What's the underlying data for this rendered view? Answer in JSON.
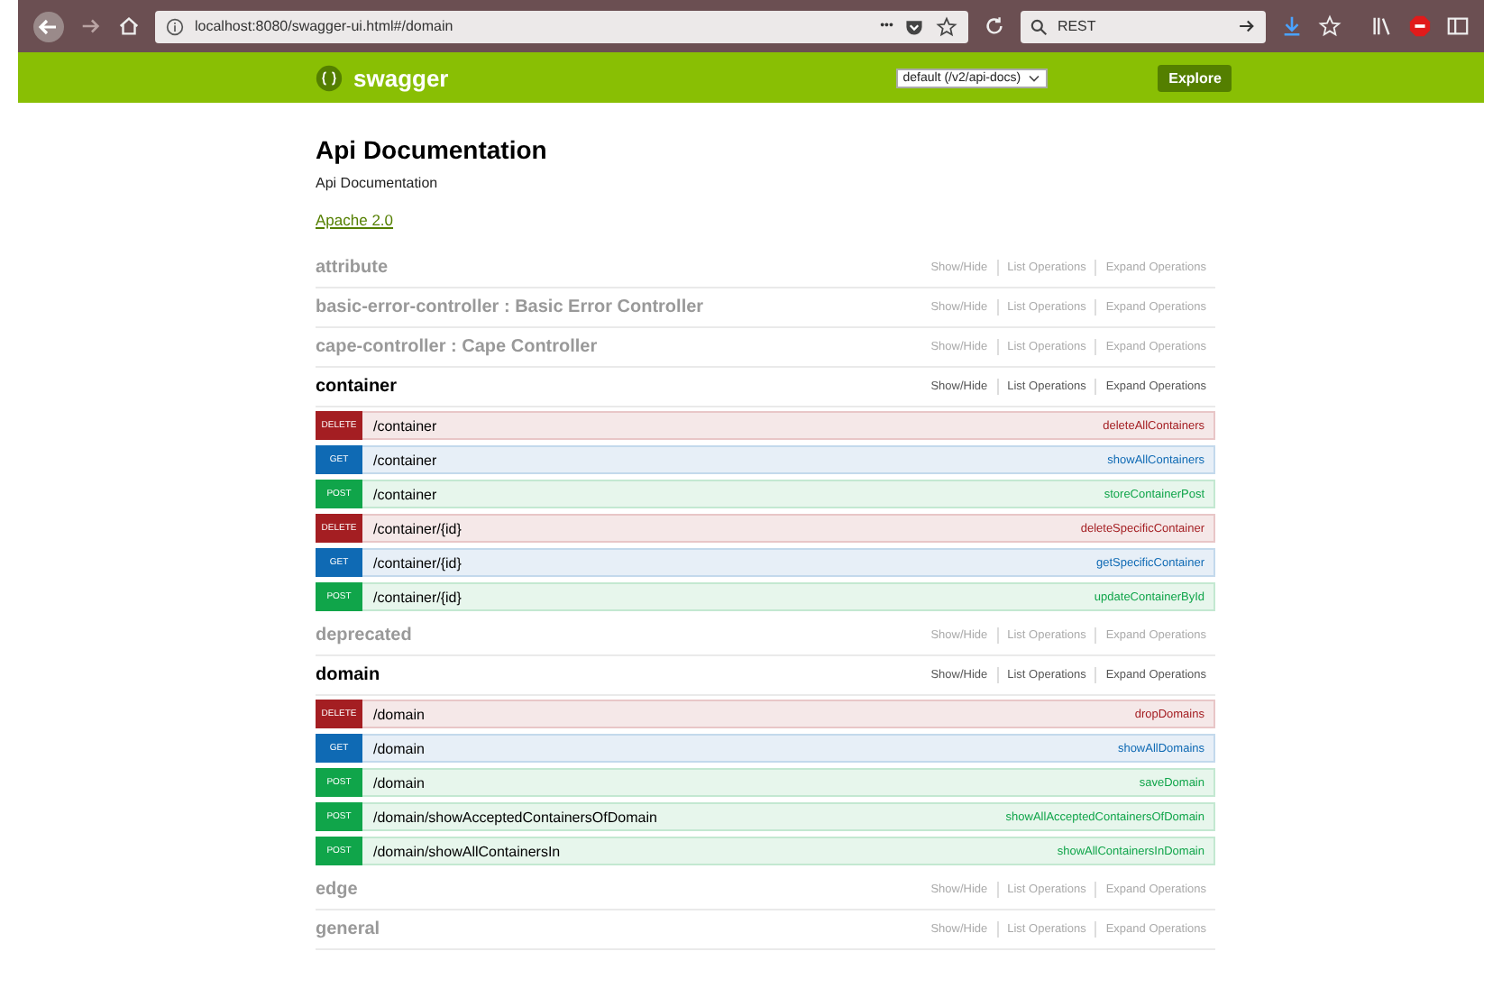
{
  "browser": {
    "url": "localhost:8080/swagger-ui.html#/domain",
    "search": "REST",
    "menu_dots": "•••"
  },
  "header": {
    "logo": "swagger",
    "api_selector": "default (/v2/api-docs)",
    "explore_button": "Explore"
  },
  "info": {
    "title": "Api Documentation",
    "description": "Api Documentation",
    "license": "Apache 2.0"
  },
  "sections": [
    {
      "name": "attribute",
      "expanded": false,
      "actions": [
        "Show/Hide",
        "List Operations",
        "Expand Operations"
      ]
    },
    {
      "name": "basic-error-controller : Basic Error Controller",
      "expanded": false,
      "actions": [
        "Show/Hide",
        "List Operations",
        "Expand Operations"
      ]
    },
    {
      "name": "cape-controller : Cape Controller",
      "expanded": false,
      "actions": [
        "Show/Hide",
        "List Operations",
        "Expand Operations"
      ]
    },
    {
      "name": "container",
      "expanded": true,
      "actions": [
        "Show/Hide",
        "List Operations",
        "Expand Operations"
      ],
      "operations": [
        {
          "kind": "delete",
          "method": "DELETE",
          "path": "/container",
          "summary": "deleteAllContainers"
        },
        {
          "kind": "get",
          "method": "GET",
          "path": "/container",
          "summary": "showAllContainers"
        },
        {
          "kind": "post",
          "method": "POST",
          "path": "/container",
          "summary": "storeContainerPost"
        },
        {
          "kind": "delete",
          "method": "DELETE",
          "path": "/container/{id}",
          "summary": "deleteSpecificContainer"
        },
        {
          "kind": "get",
          "method": "GET",
          "path": "/container/{id}",
          "summary": "getSpecificContainer"
        },
        {
          "kind": "post",
          "method": "POST",
          "path": "/container/{id}",
          "summary": "updateContainerById"
        }
      ]
    },
    {
      "name": "deprecated",
      "expanded": false,
      "actions": [
        "Show/Hide",
        "List Operations",
        "Expand Operations"
      ]
    },
    {
      "name": "domain",
      "expanded": true,
      "actions": [
        "Show/Hide",
        "List Operations",
        "Expand Operations"
      ],
      "operations": [
        {
          "kind": "delete",
          "method": "DELETE",
          "path": "/domain",
          "summary": "dropDomains"
        },
        {
          "kind": "get",
          "method": "GET",
          "path": "/domain",
          "summary": "showAllDomains"
        },
        {
          "kind": "post",
          "method": "POST",
          "path": "/domain",
          "summary": "saveDomain"
        },
        {
          "kind": "post",
          "method": "POST",
          "path": "/domain/showAcceptedContainersOfDomain",
          "summary": "showAllAcceptedContainersOfDomain"
        },
        {
          "kind": "post",
          "method": "POST",
          "path": "/domain/showAllContainersIn",
          "summary": "showAllContainersInDomain"
        }
      ]
    },
    {
      "name": "edge",
      "expanded": false,
      "actions": [
        "Show/Hide",
        "List Operations",
        "Expand Operations"
      ]
    },
    {
      "name": "general",
      "expanded": false,
      "actions": [
        "Show/Hide",
        "List Operations",
        "Expand Operations"
      ]
    }
  ]
}
